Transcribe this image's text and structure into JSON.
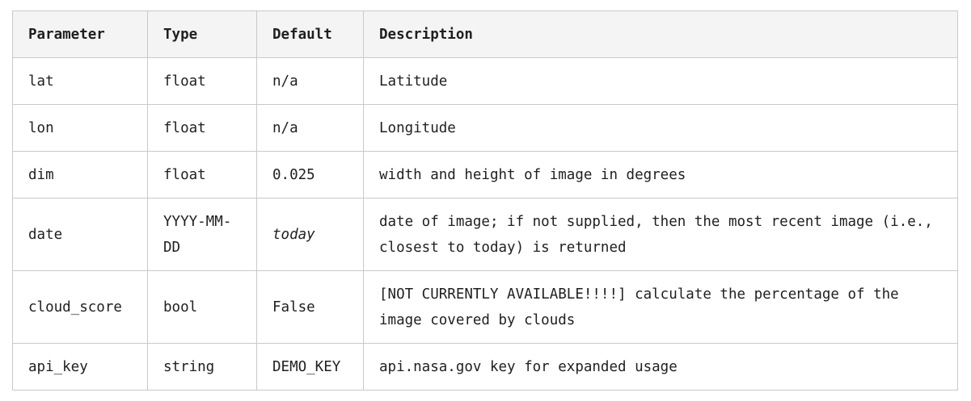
{
  "table": {
    "headers": [
      "Parameter",
      "Type",
      "Default",
      "Description"
    ],
    "rows": [
      {
        "parameter": "lat",
        "type": "float",
        "default": "n/a",
        "description": "Latitude"
      },
      {
        "parameter": "lon",
        "type": "float",
        "default": "n/a",
        "description": "Longitude"
      },
      {
        "parameter": "dim",
        "type": "float",
        "default": "0.025",
        "description": "width and height of image in degrees"
      },
      {
        "parameter": "date",
        "type": "YYYY-MM-DD",
        "default": "today",
        "description": "date of image; if not supplied, then the most recent image (i.e., closest to today) is returned"
      },
      {
        "parameter": "cloud_score",
        "type": "bool",
        "default": "False",
        "description": "[NOT CURRENTLY AVAILABLE!!!!] calculate the percentage of the image covered by clouds"
      },
      {
        "parameter": "api_key",
        "type": "string",
        "default": "DEMO_KEY",
        "description": "api.nasa.gov key for expanded usage"
      }
    ]
  }
}
